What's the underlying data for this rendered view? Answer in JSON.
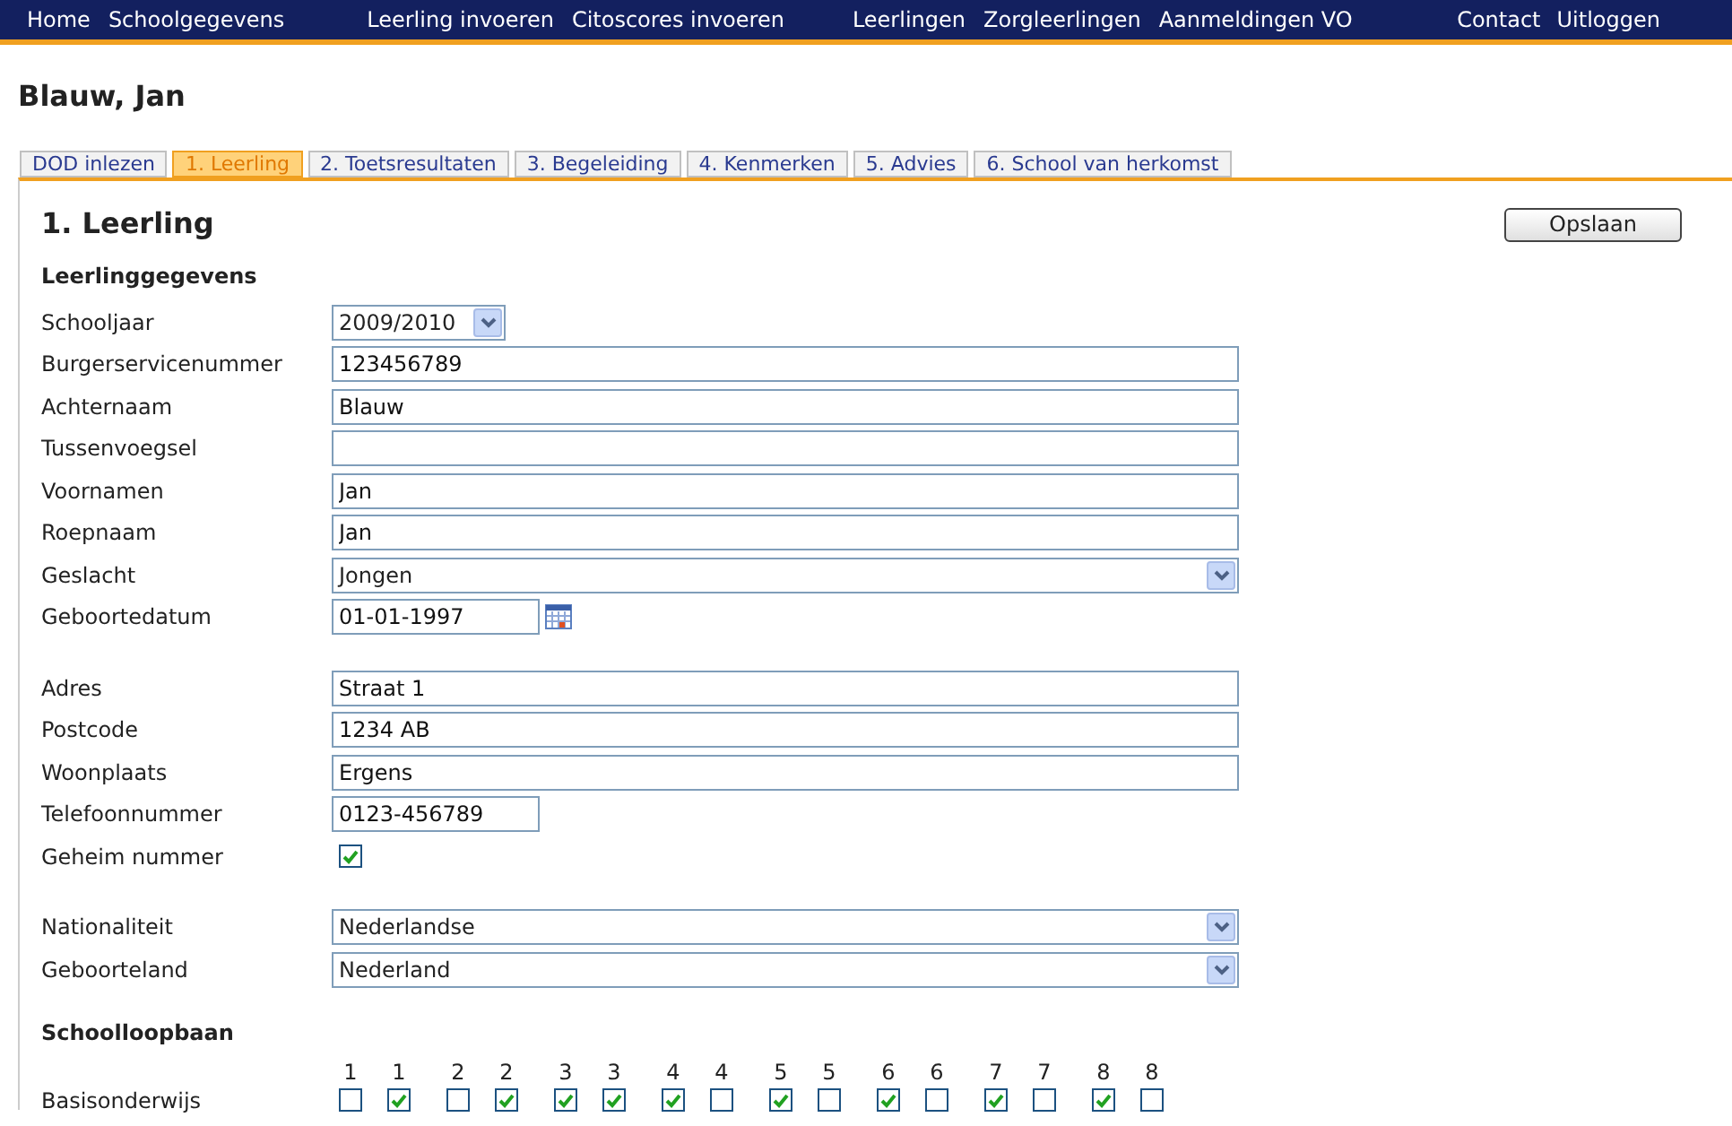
{
  "nav": {
    "groups": [
      [
        "Home",
        "Schoolgegevens"
      ],
      [
        "Leerling invoeren",
        "Citoscores invoeren"
      ],
      [
        "Leerlingen",
        "Zorgleerlingen",
        "Aanmeldingen VO"
      ]
    ],
    "right": [
      "Contact",
      "Uitloggen"
    ]
  },
  "page_title": "Blauw, Jan",
  "tabs": [
    {
      "label": "DOD inlezen",
      "selected": false
    },
    {
      "label": "1. Leerling",
      "selected": true
    },
    {
      "label": "2. Toetsresultaten",
      "selected": false
    },
    {
      "label": "3. Begeleiding",
      "selected": false
    },
    {
      "label": "4. Kenmerken",
      "selected": false
    },
    {
      "label": "5. Advies",
      "selected": false
    },
    {
      "label": "6. School van herkomst",
      "selected": false
    }
  ],
  "section_title": "1. Leerling",
  "save_button": "Opslaan",
  "subsection": "Leerlinggegevens",
  "fields": [
    {
      "kind": "small-select",
      "label": "Schooljaar",
      "value": "2009/2010"
    },
    {
      "kind": "text",
      "label": "Burgerservicenummer",
      "value": "123456789"
    },
    {
      "kind": "text",
      "label": "Achternaam",
      "value": "Blauw"
    },
    {
      "kind": "text",
      "label": "Tussenvoegsel"
    },
    {
      "kind": "text",
      "label": "Voornamen",
      "value": "Jan"
    },
    {
      "kind": "text",
      "label": "Roepnaam",
      "value": "Jan"
    },
    {
      "kind": "select",
      "label": "Geslacht",
      "value": "Jongen"
    },
    {
      "kind": "date",
      "label": "Geboortedatum",
      "value": "01-01-1997"
    },
    {
      "kind": "gap"
    },
    {
      "kind": "text",
      "label": "Adres",
      "value": "Straat 1"
    },
    {
      "kind": "text",
      "label": "Postcode",
      "value": "1234 AB"
    },
    {
      "kind": "text",
      "label": "Woonplaats",
      "value": "Ergens"
    },
    {
      "kind": "short",
      "label": "Telefoonnummer",
      "value": "0123-456789"
    },
    {
      "kind": "checkbox",
      "label": "Geheim nummer",
      "checked": true
    },
    {
      "kind": "gap"
    },
    {
      "kind": "select",
      "label": "Nationaliteit",
      "value": "Nederlandse"
    },
    {
      "kind": "select",
      "label": "Geboorteland",
      "value": "Nederland"
    }
  ],
  "schoolloopbaan": {
    "title": "Schoolloopbaan",
    "row_label": "Basisonderwijs",
    "columns": [
      {
        "label": "1",
        "checked": false
      },
      {
        "label": "1",
        "checked": true
      },
      {
        "label": "2",
        "checked": false
      },
      {
        "label": "2",
        "checked": true
      },
      {
        "label": "3",
        "checked": true
      },
      {
        "label": "3",
        "checked": true
      },
      {
        "label": "4",
        "checked": true
      },
      {
        "label": "4",
        "checked": false
      },
      {
        "label": "5",
        "checked": true
      },
      {
        "label": "5",
        "checked": false
      },
      {
        "label": "6",
        "checked": true
      },
      {
        "label": "6",
        "checked": false
      },
      {
        "label": "7",
        "checked": true
      },
      {
        "label": "7",
        "checked": false
      },
      {
        "label": "8",
        "checked": true
      },
      {
        "label": "8",
        "checked": false
      }
    ]
  }
}
